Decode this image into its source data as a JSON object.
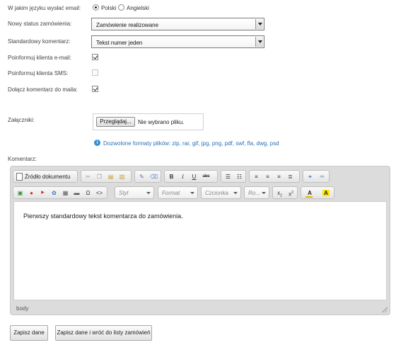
{
  "form": {
    "language_label": "W jakim języku wysłać email:",
    "lang_polish": "Polski",
    "lang_english": "Angielski",
    "status_label": "Nowy status zamówienia:",
    "status_value": "Zamówienie realizowane",
    "comment_label": "Standardowy komentarz:",
    "comment_value": "Tekst numer jeden",
    "notify_email_label": "Poinformuj klienta e-mail:",
    "notify_email_checked": true,
    "notify_sms_label": "Poinformuj klienta SMS:",
    "notify_sms_checked": false,
    "attach_comment_label": "Dołącz komentarz do maila:",
    "attach_comment_checked": true,
    "attachments_label": "Załączniki:",
    "browse_button": "Przeglądaj...",
    "no_file_text": "Nie wybrano pliku.",
    "allowed_formats": "Dozwolone formaty plików: zip, rar, gif, jpg, png, pdf, swf, fla, dwg, psd",
    "comment_area_label": "Komentarz:"
  },
  "editor": {
    "source_label": "Źródło dokumentu",
    "style_combo": "Styl",
    "format_combo": "Format",
    "font_combo": "Czcionka",
    "size_combo": "Ro...",
    "content": "Pierwszy standardowy tekst komentarza do zamówienia.",
    "path": "body",
    "accent_text_color": "#e0b400",
    "accent_bg_color": "#ffe600"
  },
  "buttons": {
    "save": "Zapisz dane",
    "save_back": "Zapisz dane i wróć do listy zamówień"
  }
}
